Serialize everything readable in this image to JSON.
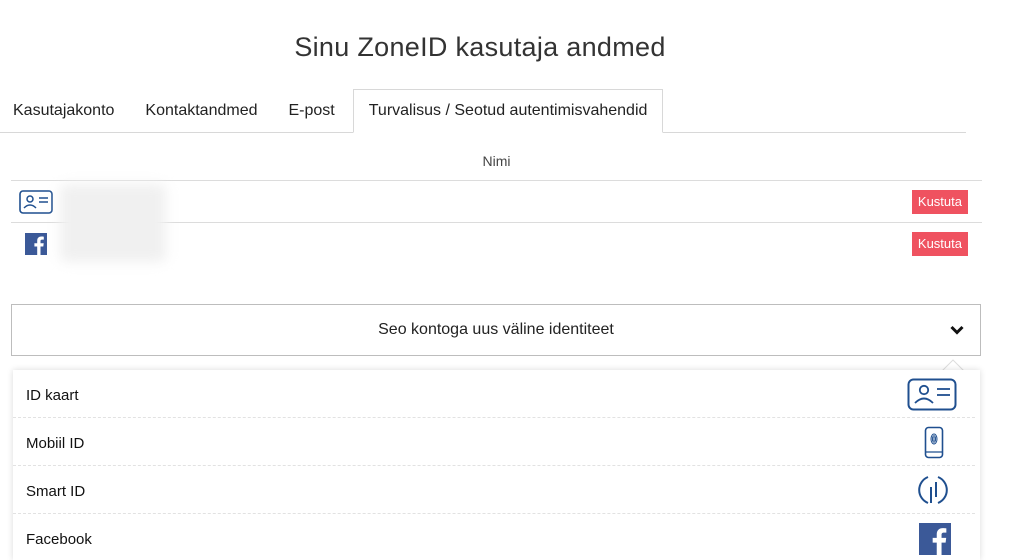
{
  "page": {
    "title": "Sinu ZoneID kasutaja andmed"
  },
  "tabs": [
    {
      "label": "Kasutajakonto"
    },
    {
      "label": "Kontaktandmed"
    },
    {
      "label": "E-post"
    },
    {
      "label": "Turvalisus / Seotud autentimisvahendid",
      "active": true
    }
  ],
  "table": {
    "header": "Nimi",
    "rows": [
      {
        "icon": "id-card-icon",
        "action": "Kustuta"
      },
      {
        "icon": "facebook-icon",
        "action": "Kustuta"
      }
    ]
  },
  "link_select": {
    "label": "Seo kontoga uus väline identiteet",
    "icon": "chevron-down-icon"
  },
  "options": [
    {
      "label": "ID kaart",
      "icon": "id-card-icon"
    },
    {
      "label": "Mobiil ID",
      "icon": "mobile-fingerprint-icon"
    },
    {
      "label": "Smart ID",
      "icon": "smart-id-icon"
    },
    {
      "label": "Facebook",
      "icon": "facebook-icon"
    }
  ],
  "colors": {
    "icon_blue": "#1f4f8f",
    "delete_red": "#ef5260",
    "facebook_blue": "#3b5998"
  }
}
